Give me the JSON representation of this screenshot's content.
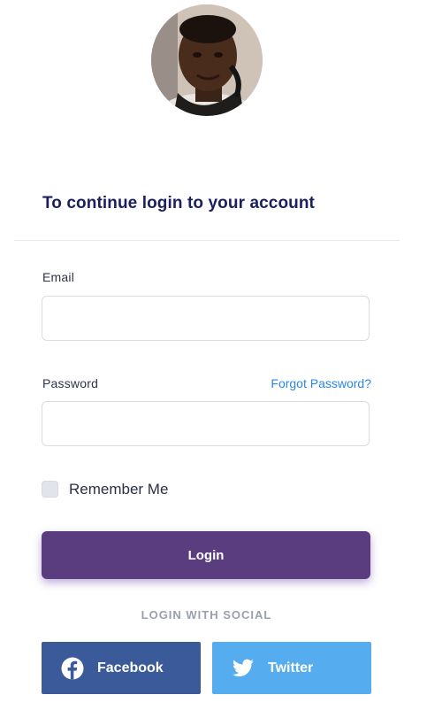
{
  "heading": "To continue login to your account",
  "email": {
    "label": "Email",
    "value": "",
    "placeholder": ""
  },
  "password": {
    "label": "Password",
    "value": "",
    "placeholder": "",
    "forgot_link": "Forgot Password?"
  },
  "remember": {
    "label": "Remember Me",
    "checked": false
  },
  "login_button": "Login",
  "social": {
    "title": "LOGIN WITH SOCIAL",
    "facebook": {
      "label": "Facebook",
      "icon": "facebook-icon",
      "color": "#3b5a99"
    },
    "twitter": {
      "label": "Twitter",
      "icon": "twitter-icon",
      "color": "#55acee"
    }
  },
  "colors": {
    "heading": "#1b1f5e",
    "primary": "#5a3d7e",
    "link": "#2a86e6"
  }
}
